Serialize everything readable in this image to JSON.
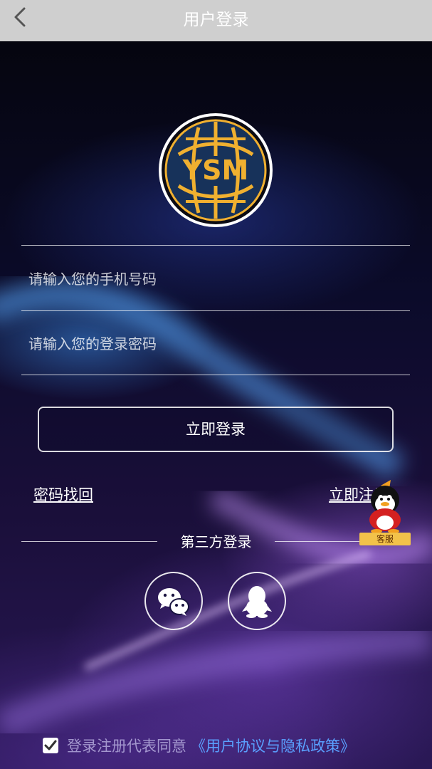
{
  "header": {
    "title": "用户登录"
  },
  "form": {
    "phone_placeholder": "请输入您的手机号码",
    "password_placeholder": "请输入您的登录密码",
    "login_label": "立即登录"
  },
  "links": {
    "forgot": "密码找回",
    "register": "立即注册"
  },
  "third_party": {
    "title": "第三方登录",
    "icons": [
      "wechat-icon",
      "qq-icon"
    ]
  },
  "service": {
    "label": "客服"
  },
  "agreement": {
    "text": "登录注册代表同意",
    "link": "《用户协议与隐私政策》",
    "checked": true
  },
  "logo": {
    "text": "YSM"
  },
  "colors": {
    "header_bg": "#cfcfcf",
    "link_blue": "#5aa0ff",
    "logo_gold": "#f0b030",
    "logo_navy": "#17325a"
  }
}
